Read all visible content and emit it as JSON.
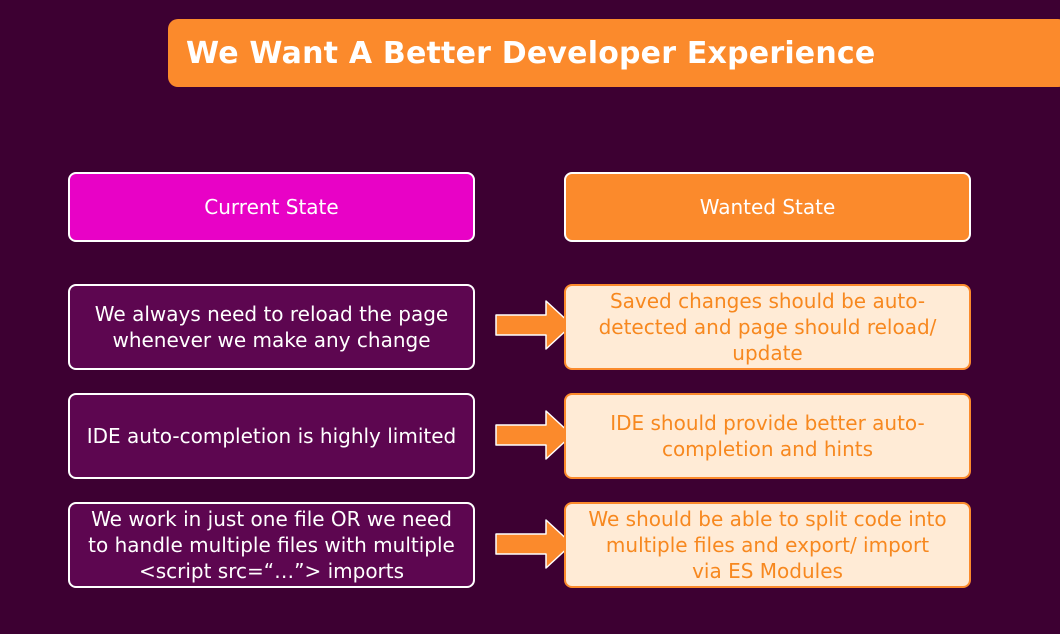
{
  "slide": {
    "title": "We Want A Better Developer Experience"
  },
  "columns": {
    "current_header": "Current State",
    "wanted_header": "Wanted State"
  },
  "rows": [
    {
      "current": "We always need to reload the page whenever we make any change",
      "wanted": "Saved changes should be auto-detected and page should reload/ update"
    },
    {
      "current": "IDE auto-completion is highly limited",
      "wanted": "IDE should provide better auto-completion and hints"
    },
    {
      "current": "We work in just one file OR we need to handle multiple files with multiple <script src=“…”> imports",
      "wanted": "We should be able to split code into multiple files and export/ import via ES Modules"
    }
  ],
  "colors": {
    "background": "#3d0032",
    "accent_orange": "#fb8a2c",
    "accent_magenta": "#e802c6",
    "current_box": "#5d0650",
    "wanted_box": "#ffebd6"
  },
  "icons": [
    "arrow-right-icon"
  ]
}
